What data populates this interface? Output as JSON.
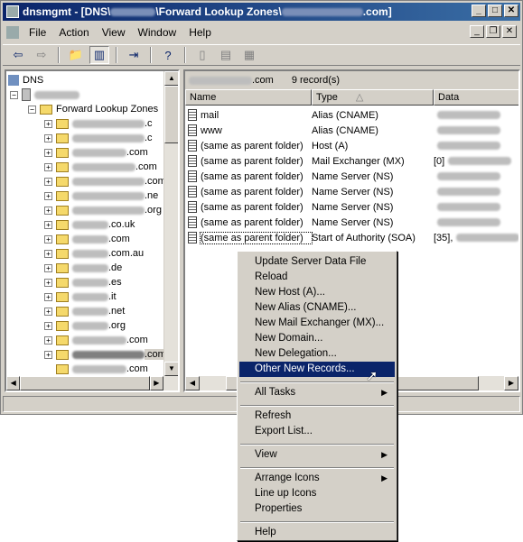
{
  "title": {
    "prefix": "dnsmgmt - [DNS\\",
    "suffix": "\\Forward Lookup Zones\\",
    "end": ".com]"
  },
  "menu": [
    "File",
    "Action",
    "View",
    "Window",
    "Help"
  ],
  "tree": {
    "root": "DNS",
    "zones_label": "Forward Lookup Zones",
    "items": [
      ".c",
      ".c",
      ".com",
      ".com",
      ".com",
      ".ne",
      ".org",
      ".co.uk",
      ".com",
      ".com.au",
      ".de",
      ".es",
      ".it",
      ".net",
      ".org",
      ".com",
      ".com",
      ".com"
    ]
  },
  "list": {
    "header_suffix": ".com",
    "record_count": "9 record(s)",
    "columns": [
      "Name",
      "Type",
      "Data"
    ],
    "rows": [
      {
        "name": "mail",
        "type": "Alias (CNAME)",
        "data": ""
      },
      {
        "name": "www",
        "type": "Alias (CNAME)",
        "data": ""
      },
      {
        "name": "(same as parent folder)",
        "type": "Host (A)",
        "data": ""
      },
      {
        "name": "(same as parent folder)",
        "type": "Mail Exchanger (MX)",
        "data": "[0]"
      },
      {
        "name": "(same as parent folder)",
        "type": "Name Server (NS)",
        "data": ""
      },
      {
        "name": "(same as parent folder)",
        "type": "Name Server (NS)",
        "data": ""
      },
      {
        "name": "(same as parent folder)",
        "type": "Name Server (NS)",
        "data": ""
      },
      {
        "name": "(same as parent folder)",
        "type": "Name Server (NS)",
        "data": ""
      },
      {
        "name": "(same as parent folder)",
        "type": "Start of Authority (SOA)",
        "data": "[35],"
      }
    ]
  },
  "context_menu": {
    "items": [
      "Update Server Data File",
      "Reload",
      "New Host (A)...",
      "New Alias (CNAME)...",
      "New Mail Exchanger (MX)...",
      "New Domain...",
      "New Delegation...",
      "Other New Records...",
      "All Tasks",
      "Refresh",
      "Export List...",
      "View",
      "Arrange Icons",
      "Line up Icons",
      "Properties",
      "Help"
    ]
  }
}
